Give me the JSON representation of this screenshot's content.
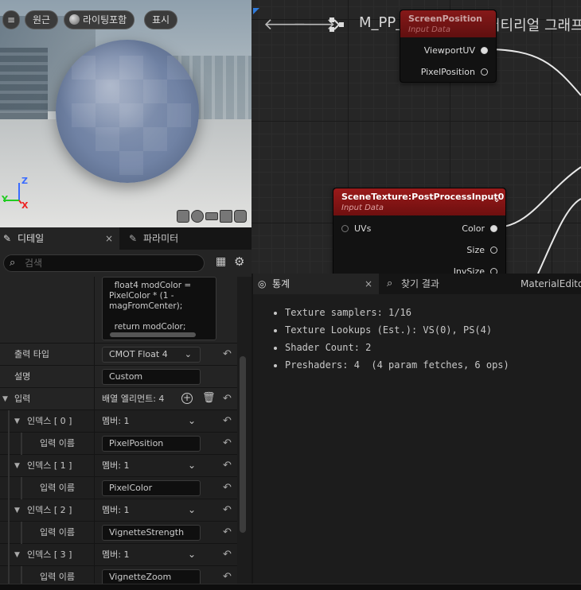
{
  "viewport": {
    "menu_icon": "hamburger-icon",
    "perspective_label": "원근",
    "lighting_label": "라이팅포함",
    "show_label": "표시",
    "axis": {
      "x": "X",
      "y": "Y",
      "z": "Z"
    }
  },
  "details_panel": {
    "details_tab": "디테일",
    "params_tab": "파라미터",
    "search_placeholder": "검색",
    "code_text": "  float4 modColor =\nPixelColor * (1 -\nmagFromCenter);\n\n  return modColor;",
    "output_type_label": "출력 타입",
    "output_type_value": "CMOT Float 4",
    "description_label": "설명",
    "description_value": "Custom",
    "inputs_label": "입력",
    "array_elements": "배열 엘리먼트: 4",
    "indices": [
      {
        "label": "인덱스 [ 0 ]",
        "members": "멤버: 1",
        "input_name_label": "입력 이름",
        "input_name": "PixelPosition"
      },
      {
        "label": "인덱스 [ 1 ]",
        "members": "멤버: 1",
        "input_name_label": "입력 이름",
        "input_name": "PixelColor"
      },
      {
        "label": "인덱스 [ 2 ]",
        "members": "멤버: 1",
        "input_name_label": "입력 이름",
        "input_name": "VignetteStrength"
      },
      {
        "label": "인덱스 [ 3 ]",
        "members": "멤버: 1",
        "input_name_label": "입력 이름",
        "input_name": "VignetteZoom"
      }
    ]
  },
  "graph": {
    "breadcrumb_asset": "M_PP_Vinetting",
    "breadcrumb_graph": "머티리얼 그래프",
    "node_screen": {
      "title": "ScreenPosition",
      "subtitle": "Input Data",
      "pins": [
        "ViewportUV",
        "PixelPosition"
      ]
    },
    "node_scene": {
      "title": "SceneTexture:PostProcessInput0",
      "subtitle": "Input Data",
      "input_pins": [
        "UVs"
      ],
      "output_pins": [
        "Color",
        "Size",
        "InvSize"
      ]
    }
  },
  "stats_panel": {
    "stats_tab": "통계",
    "find_tab": "찾기 결과",
    "editor_tab": "MaterialEditor",
    "lines": [
      "Texture samplers: 1/16",
      "Texture Lookups (Est.): VS(0), PS(4)",
      "Shader Count: 2",
      "Preshaders: 4  (4 param fetches, 6 ops)"
    ]
  },
  "colors": {
    "node_header": "#8b1414",
    "background": "#151515",
    "panel": "#242424"
  }
}
